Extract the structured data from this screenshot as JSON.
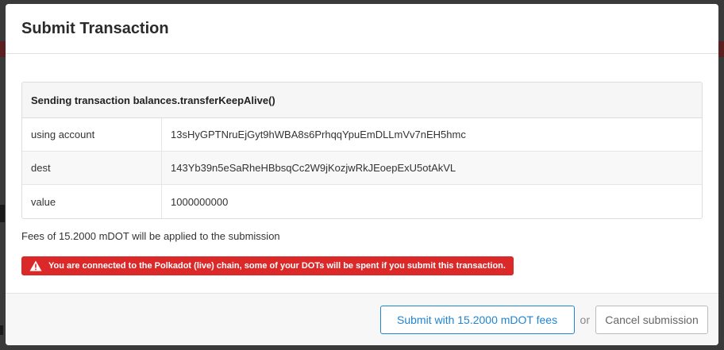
{
  "modal": {
    "title": "Submit Transaction"
  },
  "transaction": {
    "header": "Sending transaction balances.transferKeepAlive()",
    "rows": [
      {
        "label": "using account",
        "value": "13sHyGPTNruEjGyt9hWBA8s6PrhqqYpuEmDLLmVv7nEH5hmc"
      },
      {
        "label": "dest",
        "value": "143Yb39n5eSaRheHBbsqCc2W9jKozjwRkJEoepExU5otAkVL"
      },
      {
        "label": "value",
        "value": "1000000000"
      }
    ]
  },
  "fees_text": "Fees of 15.2000 mDOT will be applied to the submission",
  "warning": {
    "icon": "warning-icon",
    "text": "You are connected to the Polkadot (live) chain, some of your DOTs will be spent if you submit this transaction.",
    "color": "#db2828"
  },
  "footer": {
    "submit_label": "Submit with 15.2000 mDOT fees",
    "or_text": "or",
    "cancel_label": "Cancel submission"
  },
  "colors": {
    "accent": "#2185d0",
    "warning": "#db2828"
  }
}
